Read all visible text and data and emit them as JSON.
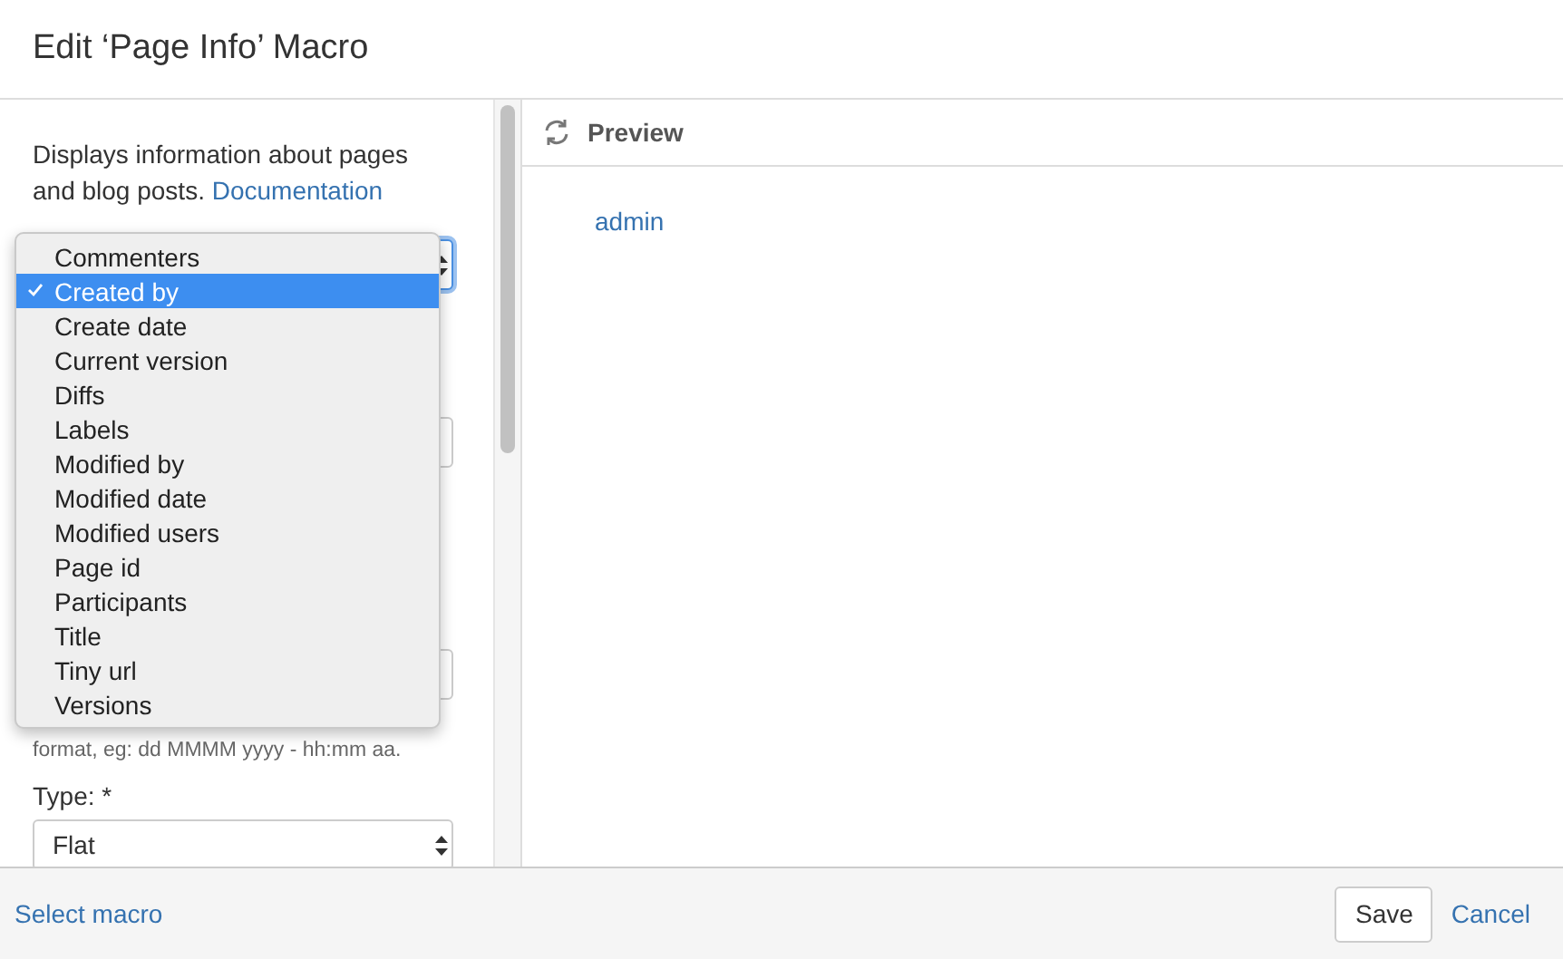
{
  "window": {
    "title": "Edit ‘Page Info’ Macro"
  },
  "description": {
    "text": "Displays information about pages and blog posts.",
    "link": "Documentation"
  },
  "info_type_select": {
    "open": true,
    "options": [
      {
        "label": "Commenters",
        "selected": false
      },
      {
        "label": "Created by",
        "selected": true
      },
      {
        "label": "Create date",
        "selected": false
      },
      {
        "label": "Current version",
        "selected": false
      },
      {
        "label": "Diffs",
        "selected": false
      },
      {
        "label": "Labels",
        "selected": false
      },
      {
        "label": "Modified by",
        "selected": false
      },
      {
        "label": "Modified date",
        "selected": false
      },
      {
        "label": "Modified users",
        "selected": false
      },
      {
        "label": "Page id",
        "selected": false
      },
      {
        "label": "Participants",
        "selected": false
      },
      {
        "label": "Title",
        "selected": false
      },
      {
        "label": "Tiny url",
        "selected": false
      },
      {
        "label": "Versions",
        "selected": false
      }
    ]
  },
  "date_format_help": "format, eg: dd MMMM yyyy - hh:mm aa.",
  "type_field": {
    "label": "Type: *",
    "value": "Flat"
  },
  "preview": {
    "title": "Preview",
    "content": "admin"
  },
  "footer": {
    "link": "Select macro",
    "buttons": [
      "Save",
      "Cancel"
    ]
  }
}
